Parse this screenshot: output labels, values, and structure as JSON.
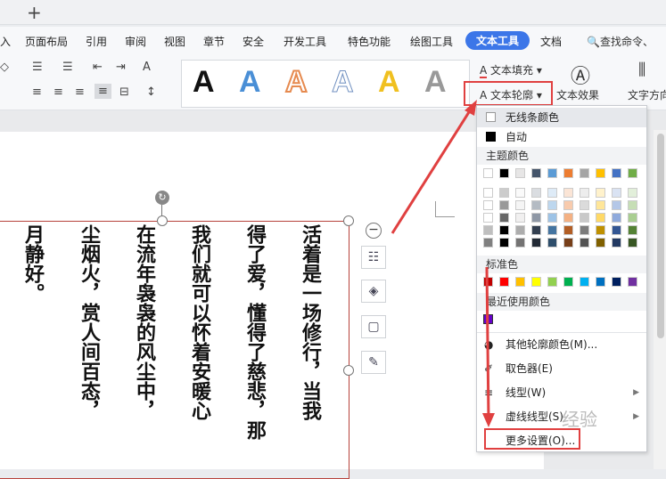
{
  "topbar": {
    "new_tab": "+"
  },
  "tabs": [
    "入",
    "页面布局",
    "引用",
    "审阅",
    "视图",
    "章节",
    "安全",
    "开发工具",
    "特色功能",
    "绘图工具",
    "文本工具",
    "文档"
  ],
  "search_label": "查找命令、",
  "ribbon": {
    "text_fill": "文本填充",
    "text_outline": "文本轮廓",
    "text_effect": "文本效果",
    "text_direction": "文字方向",
    "gallery_letter": "A",
    "gallery_colors": [
      "#111111",
      "#4a8fd6",
      "#e68a4f",
      "#8fb0d8",
      "#f0c020",
      "#999999"
    ]
  },
  "document": {
    "columns": [
      "活着是一场修行，当我",
      "得了爱，懂得了慈悲，那",
      "我们就可以怀着安暖心",
      "在流年袅袅的风尘中，",
      "尘烟火，赏人间百态，",
      "月静好。"
    ]
  },
  "dropdown": {
    "no_line": "无线条颜色",
    "auto": "自动",
    "theme_colors": "主题颜色",
    "standard_colors": "标准色",
    "recent_colors": "最近使用颜色",
    "more_colors": "其他轮廓颜色(M)...",
    "eyedropper": "取色器(E)",
    "line_type": "线型(W)",
    "dash_type": "虚线线型(S)",
    "more_settings": "更多设置(O)...",
    "theme_top": [
      "#ffffff",
      "#000000",
      "#e7e6e6",
      "#44546a",
      "#5b9bd5",
      "#ed7d31",
      "#a5a5a5",
      "#ffc000",
      "#4472c4",
      "#70ad47"
    ],
    "standard": [
      "#c00000",
      "#ff0000",
      "#ffc000",
      "#ffff00",
      "#92d050",
      "#00b050",
      "#00b0f0",
      "#0070c0",
      "#002060",
      "#7030a0"
    ],
    "recent": [
      "#6600cc"
    ]
  },
  "watermark": "经验"
}
